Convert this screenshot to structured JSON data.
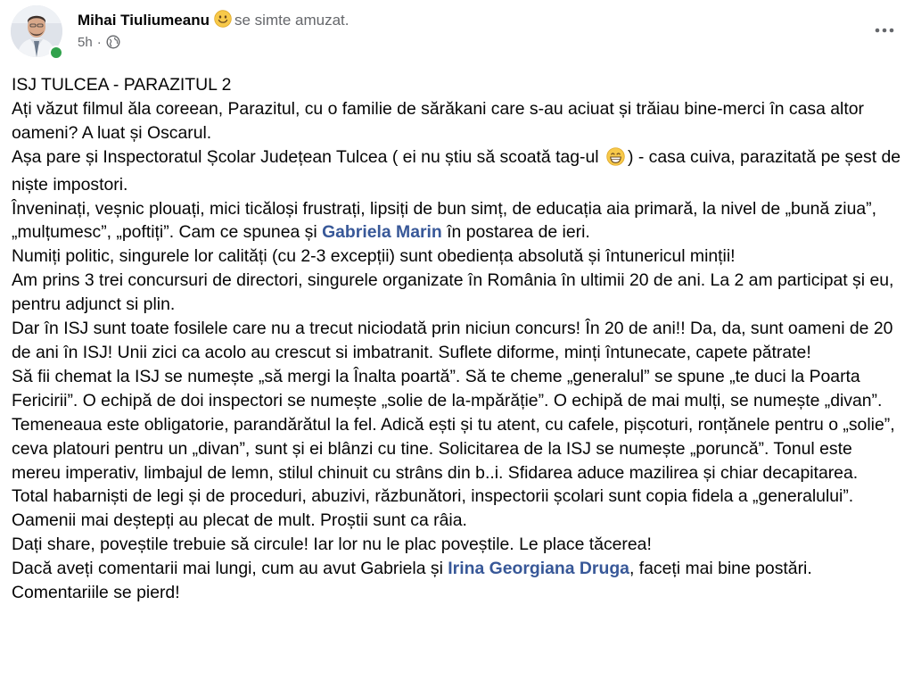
{
  "post": {
    "author": "Mihai Tiuliumeanu",
    "feeling": "se simte amuzat.",
    "time": "5h",
    "separator": "·",
    "icons": {
      "feeling_emoji": "smiling-face-icon",
      "privacy": "globe-icon",
      "more": "more-options-icon",
      "inline_emoji": "grinning-face-icon"
    },
    "colors": {
      "mention": "#385898",
      "secondary_text": "#65676b",
      "online": "#31a24c"
    }
  },
  "body": {
    "title": "ISJ TULCEA - PARAZITUL 2",
    "p2": "Ați văzut filmul ăla coreean, Parazitul, cu o familie de sărăkani care s-au aciuat și trăiau bine-merci în casa altor oameni? A luat și Oscarul.",
    "p3_a": "Așa pare și Inspectoratul Școlar Județean Tulcea ( ei nu știu să scoată tag-ul",
    "p3_b": ") - casa cuiva, parazitată pe șest de niște impostori.",
    "p4_a": "Înveninați, veșnic plouați, mici ticăloși frustrați, lipsiți de bun simț, de educația aia primară, la nivel de „bună ziua”, „mulțumesc”, „poftiți”. Cam ce spunea și",
    "mention_1": "Gabriela Marin",
    "p4_b": "în postarea de ieri.",
    "p5": "Numiți politic, singurele lor calități (cu 2-3 excepții) sunt obediența absolută și întunericul minții!",
    "p6": "Am prins 3 trei concursuri de directori, singurele organizate în România în ultimii 20 de ani. La 2 am participat și eu, pentru adjunct si plin.",
    "p7": "Dar în ISJ sunt toate fosilele care nu a trecut niciodată prin niciun concurs! În 20 de ani!! Da, da, sunt oameni de 20 de ani în ISJ! Unii zici ca acolo au crescut si imbatranit. Suflete diforme, minți întunecate, capete pătrate!",
    "p8": "Să fii chemat la ISJ se numește „să mergi la Înalta poartă”. Să te cheme „generalul” se spune „te duci la Poarta Fericirii”. O echipă de doi inspectori se numește „solie de la-mpărăție”. O echipă de mai mulți, se numește „divan”. Temeneaua este obligatorie, parandărătul la fel. Adică ești și tu atent, cu cafele, pișcoturi, ronțănele pentru o „solie”, ceva platouri pentru un „divan”, sunt și ei blânzi cu tine. Solicitarea de la ISJ se numește „poruncă”. Tonul este mereu imperativ, limbajul de lemn, stilul chinuit cu strâns din b..i. Sfidarea aduce mazilirea și chiar decapitarea.",
    "p9": "Total habarniști de legi și de proceduri, abuzivi, răzbunători, inspectorii școlari sunt copia fidela a „generalului”. Oamenii mai deștepți au plecat de mult. Proștii sunt ca râia.",
    "p10": "Dați share, poveștile trebuie să circule! Iar lor nu le plac poveștile. Le place tăcerea!",
    "p11_a": "Dacă aveți comentarii mai lungi, cum au avut Gabriela și",
    "mention_2": "Irina Georgiana Druga",
    "p11_b": ", faceți mai bine postări. Comentariile se pierd!"
  }
}
